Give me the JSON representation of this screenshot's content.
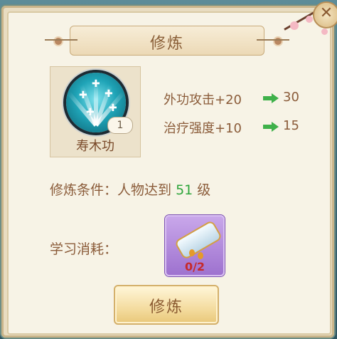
{
  "dialog": {
    "title": "修炼"
  },
  "skill": {
    "name": "寿木功",
    "level": "1",
    "icon": "heal-skill-icon"
  },
  "stats": [
    {
      "label": "外功攻击+20",
      "next": "30"
    },
    {
      "label": "治疗强度+10",
      "next": "15"
    }
  ],
  "condition": {
    "prefix": "修炼条件：人物达到",
    "level": "51",
    "suffix": "级"
  },
  "cost": {
    "label": "学习消耗：",
    "item_icon": "scroll-icon",
    "count": "0/2"
  },
  "button": {
    "train_label": "修炼"
  },
  "colors": {
    "panel": "#f7f3e6",
    "text": "#8b5c3a",
    "level_highlight": "#2ea53b",
    "insufficient": "#c62a2a",
    "arrow": "#3fb14a"
  }
}
